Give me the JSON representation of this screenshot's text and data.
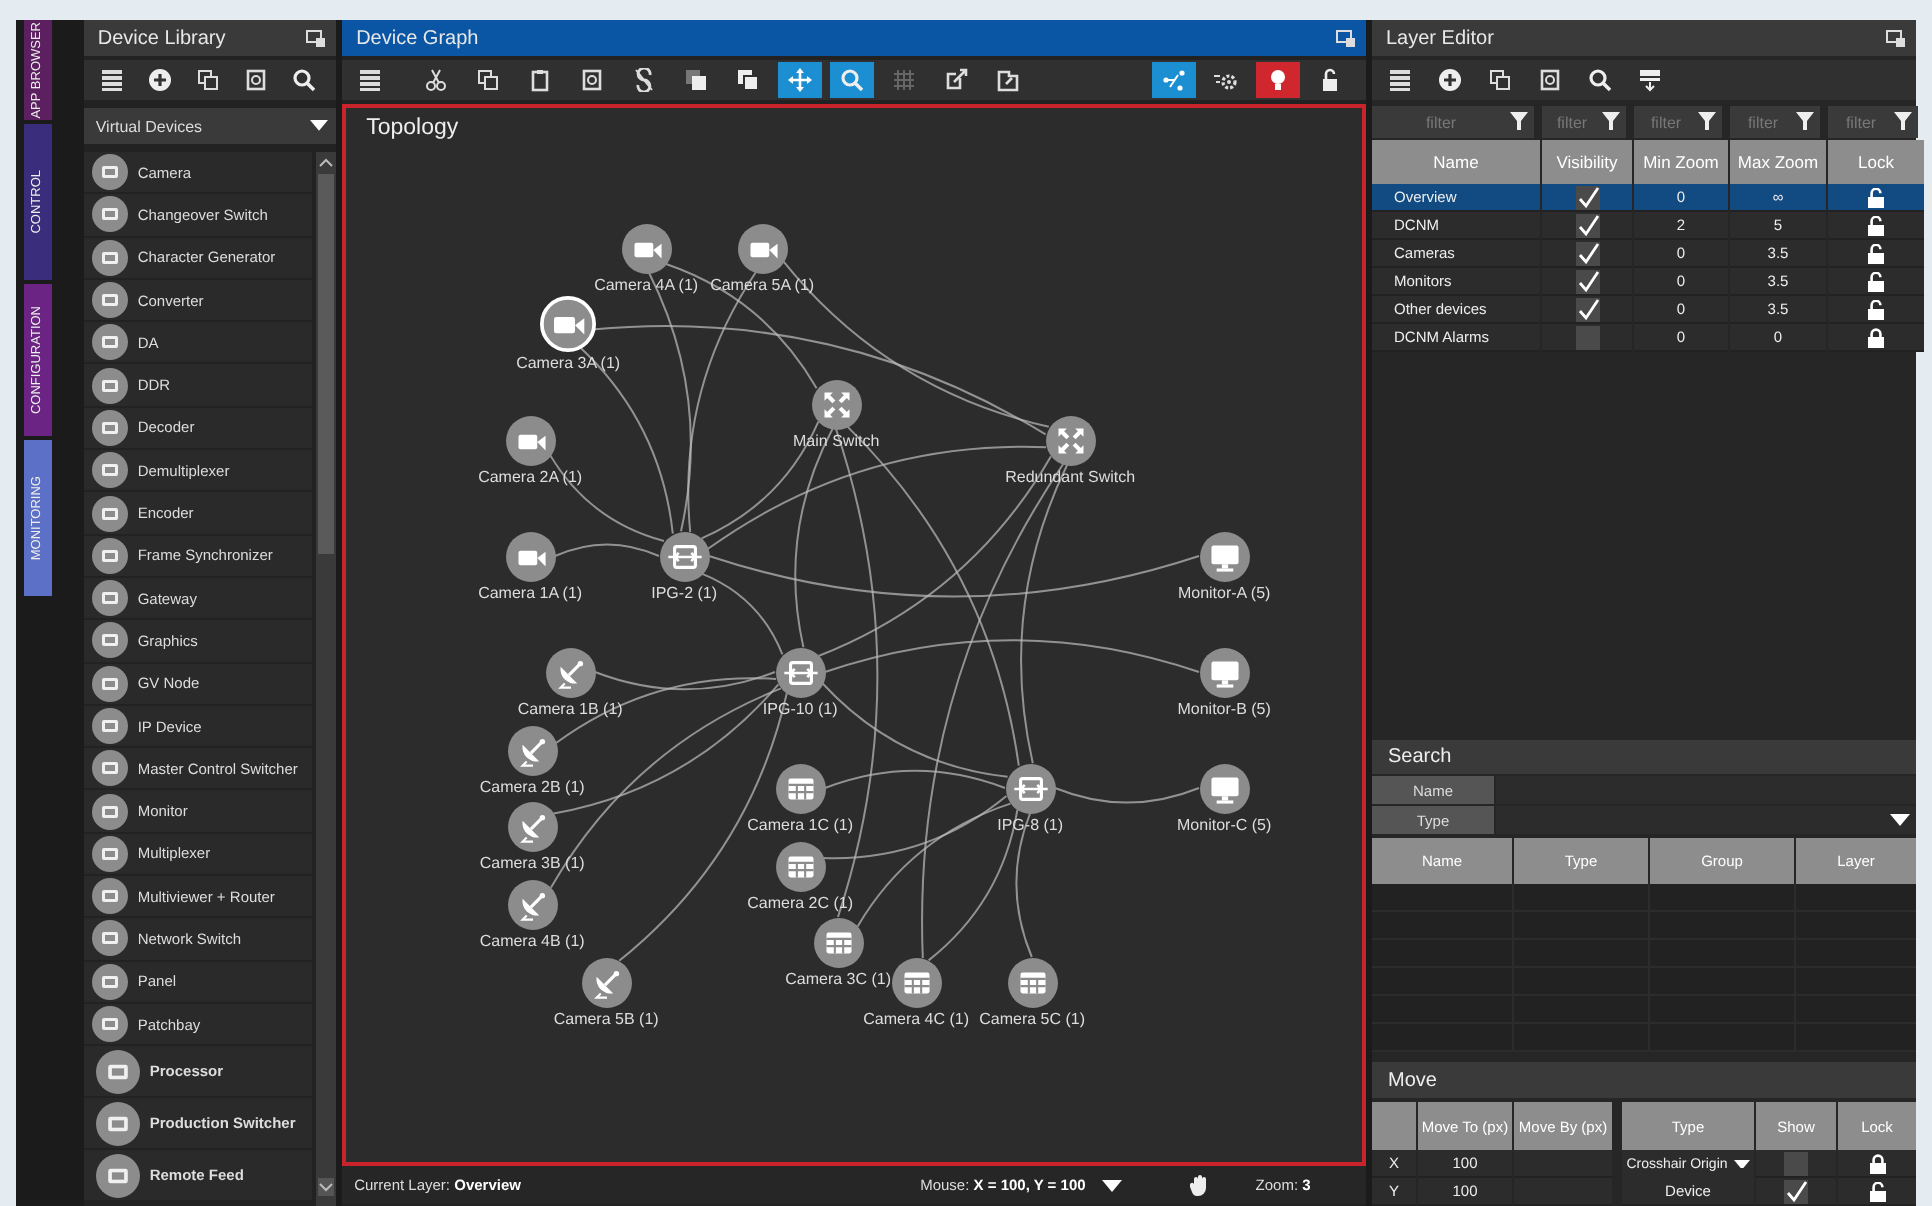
{
  "side_tabs": [
    {
      "label": "APP BROWSER",
      "color": "#5c1f5f"
    },
    {
      "label": "CONTROL",
      "color": "#3a2e7c"
    },
    {
      "label": "CONFIGURATION",
      "color": "#6b2483"
    },
    {
      "label": "MONITORING",
      "color": "#5b70c6"
    }
  ],
  "device_library": {
    "title": "Device Library",
    "tools": [
      {
        "kind": "list"
      },
      {
        "kind": "add"
      },
      {
        "kind": "copy"
      },
      {
        "kind": "delete"
      },
      {
        "kind": "search"
      }
    ],
    "category": "Virtual Devices",
    "items": [
      {
        "label": "Camera",
        "kind": "small"
      },
      {
        "label": "Changeover Switch",
        "kind": "small"
      },
      {
        "label": "Character Generator",
        "kind": "small"
      },
      {
        "label": "Converter",
        "kind": "small"
      },
      {
        "label": "DA",
        "kind": "small"
      },
      {
        "label": "DDR",
        "kind": "small"
      },
      {
        "label": "Decoder",
        "kind": "small"
      },
      {
        "label": "Demultiplexer",
        "kind": "small"
      },
      {
        "label": "Encoder",
        "kind": "small"
      },
      {
        "label": "Frame Synchronizer",
        "kind": "small"
      },
      {
        "label": "Gateway",
        "kind": "small"
      },
      {
        "label": "Graphics",
        "kind": "small"
      },
      {
        "label": "GV Node",
        "kind": "small"
      },
      {
        "label": "IP Device",
        "kind": "small"
      },
      {
        "label": "Master Control Switcher",
        "kind": "small"
      },
      {
        "label": "Monitor",
        "kind": "small"
      },
      {
        "label": "Multiplexer",
        "kind": "small"
      },
      {
        "label": "Multiviewer + Router",
        "kind": "small"
      },
      {
        "label": "Network Switch",
        "kind": "small"
      },
      {
        "label": "Panel",
        "kind": "small"
      },
      {
        "label": "Patchbay",
        "kind": "small"
      },
      {
        "label": "Processor",
        "kind": "large"
      },
      {
        "label": "Production Switcher",
        "kind": "large"
      },
      {
        "label": "Remote Feed",
        "kind": "large"
      }
    ]
  },
  "device_graph": {
    "title": "Device Graph",
    "tools": [
      {
        "kind": "list",
        "selected": false
      },
      {
        "kind": "cut",
        "selected": false
      },
      {
        "kind": "copy",
        "selected": false
      },
      {
        "kind": "paste",
        "selected": false
      },
      {
        "kind": "delete",
        "selected": false
      },
      {
        "kind": "link",
        "selected": false
      },
      {
        "kind": "front",
        "selected": false
      },
      {
        "kind": "back",
        "selected": false
      },
      {
        "kind": "move",
        "selected": true
      },
      {
        "kind": "search",
        "selected": true
      },
      {
        "kind": "grid",
        "selected": false
      },
      {
        "kind": "export",
        "selected": false
      },
      {
        "kind": "import",
        "selected": false
      }
    ],
    "tools_right": [
      {
        "kind": "layout",
        "selected": true
      },
      {
        "kind": "settings",
        "selected": false
      },
      {
        "kind": "alert",
        "selected": true
      },
      {
        "kind": "lock",
        "selected": false
      }
    ],
    "canvas_title": "Topology",
    "nodes": [
      {
        "label": "Camera 4A (1)",
        "kind": "camera",
        "selected": false
      },
      {
        "label": "Camera 5A (1)",
        "kind": "camera",
        "selected": false
      },
      {
        "label": "Camera 3A (1)",
        "kind": "camera",
        "selected": true
      },
      {
        "label": "Camera 2A (1)",
        "kind": "camera",
        "selected": false
      },
      {
        "label": "Camera 1A (1)",
        "kind": "camera",
        "selected": false
      },
      {
        "label": "Main Switch",
        "kind": "switch",
        "selected": false
      },
      {
        "label": "Redundant Switch",
        "kind": "switch",
        "selected": false
      },
      {
        "label": "IPG-2 (1)",
        "kind": "gateway",
        "selected": false
      },
      {
        "label": "Monitor-A (5)",
        "kind": "monitor",
        "selected": false
      },
      {
        "label": "Camera 1B (1)",
        "kind": "dish",
        "selected": false
      },
      {
        "label": "IPG-10 (1)",
        "kind": "gateway",
        "selected": false
      },
      {
        "label": "Monitor-B (5)",
        "kind": "monitor",
        "selected": false
      },
      {
        "label": "Camera 2B (1)",
        "kind": "dish",
        "selected": false
      },
      {
        "label": "Camera 1C (1)",
        "kind": "encoder",
        "selected": false
      },
      {
        "label": "IPG-8 (1)",
        "kind": "gateway",
        "selected": false
      },
      {
        "label": "Monitor-C (5)",
        "kind": "monitor",
        "selected": false
      },
      {
        "label": "Camera 3B (1)",
        "kind": "dish",
        "selected": false
      },
      {
        "label": "Camera 2C (1)",
        "kind": "encoder",
        "selected": false
      },
      {
        "label": "Camera 4B (1)",
        "kind": "dish",
        "selected": false
      },
      {
        "label": "Camera 3C (1)",
        "kind": "encoder",
        "selected": false
      },
      {
        "label": "Camera 5B (1)",
        "kind": "dish",
        "selected": false
      },
      {
        "label": "Camera 4C (1)",
        "kind": "encoder",
        "selected": false
      },
      {
        "label": "Camera 5C (1)",
        "kind": "encoder",
        "selected": false
      }
    ],
    "status": {
      "current_layer": "Current Layer: **Overview**",
      "mouse": "Mouse: **X = 100, Y = 100**",
      "zoom": "Zoom: **3**"
    }
  },
  "layer_editor": {
    "title": "Layer Editor",
    "tools": [
      {
        "kind": "list"
      },
      {
        "kind": "add"
      },
      {
        "kind": "copy"
      },
      {
        "kind": "delete"
      },
      {
        "kind": "search"
      },
      {
        "kind": "merge"
      }
    ],
    "filters": [
      {
        "placeholder": "filter"
      },
      {
        "placeholder": "filter"
      },
      {
        "placeholder": "filter"
      },
      {
        "placeholder": "filter"
      },
      {
        "placeholder": "filter"
      }
    ],
    "columns": [
      "Name",
      "Visibility",
      "Min Zoom",
      "Max Zoom",
      "Lock"
    ],
    "rows": [
      {
        "name": "Overview",
        "visible": true,
        "min_zoom": "0",
        "max_zoom": "∞",
        "locked": false,
        "selected": true
      },
      {
        "name": "DCNM",
        "visible": true,
        "min_zoom": "2",
        "max_zoom": "5",
        "locked": false,
        "selected": false
      },
      {
        "name": "Cameras",
        "visible": true,
        "min_zoom": "0",
        "max_zoom": "3.5",
        "locked": false,
        "selected": false
      },
      {
        "name": "Monitors",
        "visible": true,
        "min_zoom": "0",
        "max_zoom": "3.5",
        "locked": false,
        "selected": false
      },
      {
        "name": "Other devices",
        "visible": true,
        "min_zoom": "0",
        "max_zoom": "3.5",
        "locked": false,
        "selected": false
      },
      {
        "name": "DCNM Alarms",
        "visible": false,
        "min_zoom": "0",
        "max_zoom": "0",
        "locked": true,
        "selected": false
      }
    ]
  },
  "search": {
    "title": "Search",
    "fields": [
      {
        "label": "Name",
        "kind": "text"
      },
      {
        "label": "Type",
        "kind": "dropdown"
      }
    ],
    "columns": [
      "Name",
      "Type",
      "Group",
      "Layer"
    ]
  },
  "move": {
    "title": "Move",
    "columns": [
      "Move To (px)",
      "Move By (px)"
    ],
    "option_columns": [
      "Type",
      "Show",
      "Lock"
    ],
    "rows": [
      {
        "axis": "X",
        "move_to": "100",
        "type": "Crosshair Origin",
        "kind": "dropdown",
        "show": false,
        "locked": true
      },
      {
        "axis": "Y",
        "move_to": "100",
        "type": "Device",
        "kind": "text",
        "show": true,
        "locked": false
      }
    ]
  }
}
